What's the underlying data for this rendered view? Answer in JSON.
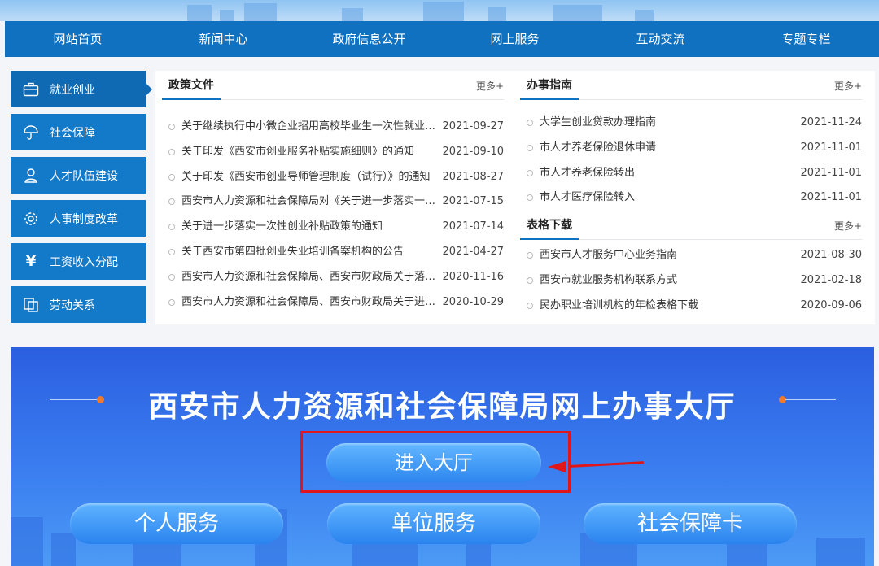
{
  "nav": {
    "items": [
      "网站首页",
      "新闻中心",
      "政府信息公开",
      "网上服务",
      "互动交流",
      "专题专栏"
    ]
  },
  "sidebar": {
    "items": [
      {
        "label": "就业创业",
        "icon": "briefcase-icon"
      },
      {
        "label": "社会保障",
        "icon": "umbrella-icon"
      },
      {
        "label": "人才队伍建设",
        "icon": "person-icon"
      },
      {
        "label": "人事制度改革",
        "icon": "gear-icon"
      },
      {
        "label": "工资收入分配",
        "icon": "yuan-icon"
      },
      {
        "label": "劳动关系",
        "icon": "document-icon"
      }
    ]
  },
  "policy": {
    "title": "政策文件",
    "more": "更多+",
    "items": [
      {
        "title": "关于继续执行中小微企业招用高校毕业生一次性就业补…",
        "date": "2021-09-27"
      },
      {
        "title": "关于印发《西安市创业服务补贴实施细则》的通知",
        "date": "2021-09-10"
      },
      {
        "title": "关于印发《西安市创业导师管理制度（试行）》的通知",
        "date": "2021-08-27"
      },
      {
        "title": "西安市人力资源和社会保障局对《关于进一步落实一次…",
        "date": "2021-07-15"
      },
      {
        "title": "关于进一步落实一次性创业补贴政策的通知",
        "date": "2021-07-14"
      },
      {
        "title": "关于西安市第四批创业失业培训备案机构的公告",
        "date": "2021-04-27"
      },
      {
        "title": "西安市人力资源和社会保障局、西安市财政局关于落实…",
        "date": "2020-11-16"
      },
      {
        "title": "西安市人力资源和社会保障局、西安市财政局关于进一…",
        "date": "2020-10-29"
      }
    ]
  },
  "guide": {
    "title": "办事指南",
    "more": "更多+",
    "items": [
      {
        "title": "大学生创业贷款办理指南",
        "date": "2021-11-24"
      },
      {
        "title": "市人才养老保险退休申请",
        "date": "2021-11-01"
      },
      {
        "title": "市人才养老保险转出",
        "date": "2021-11-01"
      },
      {
        "title": "市人才医疗保险转入",
        "date": "2021-11-01"
      }
    ]
  },
  "forms": {
    "title": "表格下载",
    "more": "更多+",
    "items": [
      {
        "title": "西安市人才服务中心业务指南",
        "date": "2021-08-30"
      },
      {
        "title": "西安市就业服务机构联系方式",
        "date": "2021-02-18"
      },
      {
        "title": "民办职业培训机构的年检表格下载",
        "date": "2020-09-06"
      }
    ]
  },
  "hall": {
    "title": "西安市人力资源和社会保障局网上办事大厅",
    "enter": "进入大厅",
    "services": [
      "个人服务",
      "单位服务",
      "社会保障卡"
    ],
    "accent": "#f27a2a",
    "highlight": "#e0161b"
  }
}
